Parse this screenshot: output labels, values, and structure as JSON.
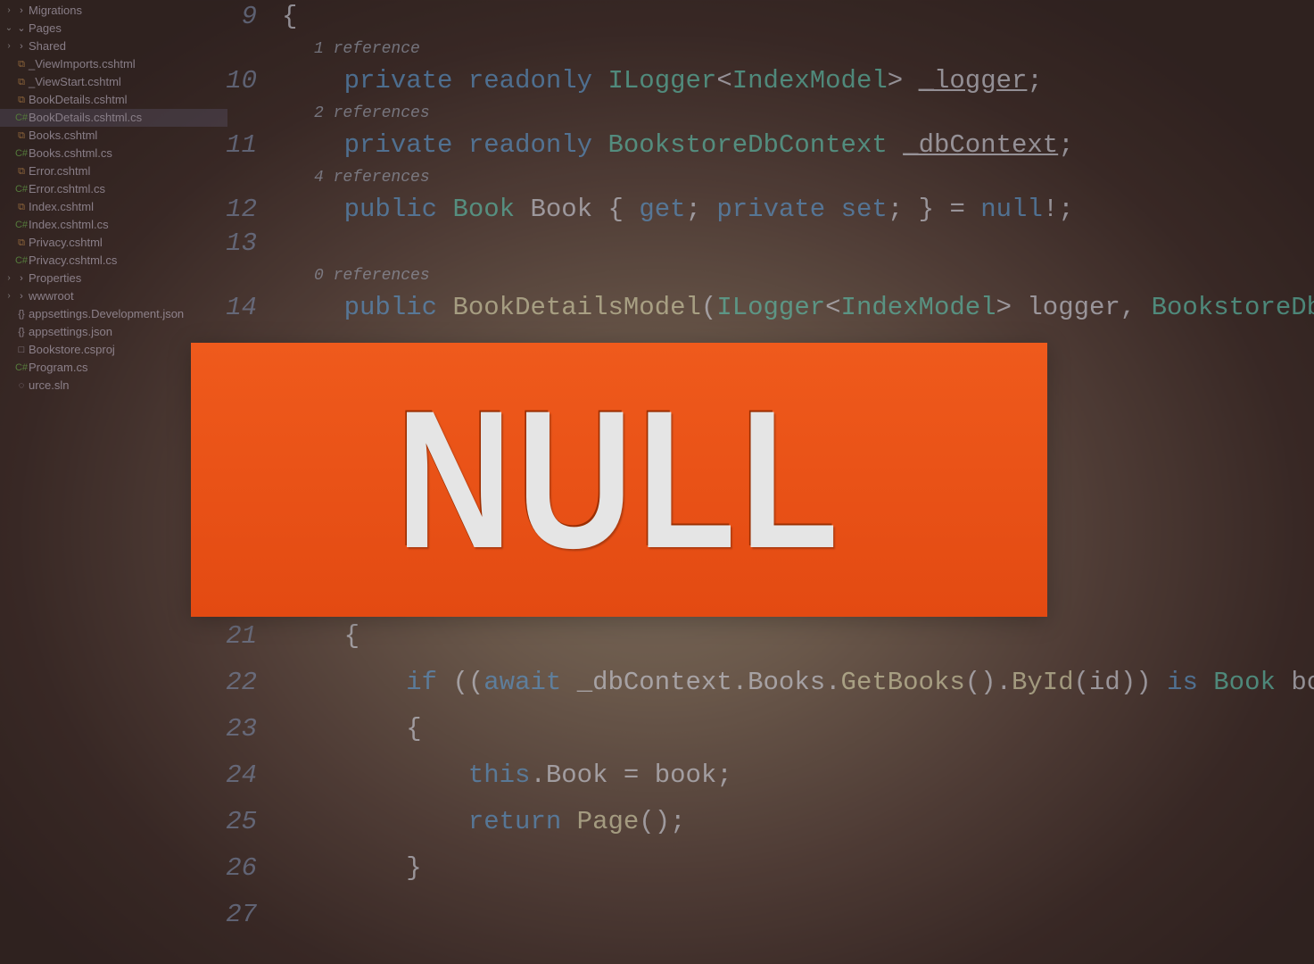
{
  "banner": {
    "text": "NULL"
  },
  "sidebar": [
    {
      "icon": "›",
      "iconClass": "",
      "label": "Migrations",
      "indent": "ind1",
      "chev": "›"
    },
    {
      "icon": "⌄",
      "iconClass": "",
      "label": "Pages",
      "indent": "ind1",
      "chev": "⌄"
    },
    {
      "icon": "›",
      "iconClass": "",
      "label": "Shared",
      "indent": "ind2",
      "chev": "›"
    },
    {
      "icon": "⧉",
      "iconClass": "icon-html",
      "label": "_ViewImports.cshtml",
      "indent": "ind2"
    },
    {
      "icon": "⧉",
      "iconClass": "icon-html",
      "label": "_ViewStart.cshtml",
      "indent": "ind2"
    },
    {
      "icon": "⧉",
      "iconClass": "icon-html",
      "label": "BookDetails.cshtml",
      "indent": "ind2"
    },
    {
      "icon": "C#",
      "iconClass": "icon-cs",
      "label": "BookDetails.cshtml.cs",
      "indent": "ind2",
      "sel": true
    },
    {
      "icon": "⧉",
      "iconClass": "icon-html",
      "label": "Books.cshtml",
      "indent": "ind2"
    },
    {
      "icon": "C#",
      "iconClass": "icon-cs",
      "label": "Books.cshtml.cs",
      "indent": "ind2"
    },
    {
      "icon": "⧉",
      "iconClass": "icon-html",
      "label": "Error.cshtml",
      "indent": "ind2"
    },
    {
      "icon": "C#",
      "iconClass": "icon-cs",
      "label": "Error.cshtml.cs",
      "indent": "ind2"
    },
    {
      "icon": "⧉",
      "iconClass": "icon-html",
      "label": "Index.cshtml",
      "indent": "ind2"
    },
    {
      "icon": "C#",
      "iconClass": "icon-cs",
      "label": "Index.cshtml.cs",
      "indent": "ind2"
    },
    {
      "icon": "⧉",
      "iconClass": "icon-html",
      "label": "Privacy.cshtml",
      "indent": "ind2"
    },
    {
      "icon": "C#",
      "iconClass": "icon-cs",
      "label": "Privacy.cshtml.cs",
      "indent": "ind2"
    },
    {
      "icon": "›",
      "iconClass": "",
      "label": "Properties",
      "indent": "ind0",
      "chev": "›"
    },
    {
      "icon": "›",
      "iconClass": "",
      "label": "wwwroot",
      "indent": "ind0",
      "chev": "›"
    },
    {
      "icon": "{}",
      "iconClass": "",
      "label": "appsettings.Development.json",
      "indent": "indm1"
    },
    {
      "icon": "{}",
      "iconClass": "",
      "label": "appsettings.json",
      "indent": "indm1"
    },
    {
      "icon": "□",
      "iconClass": "",
      "label": "Bookstore.csproj",
      "indent": "indm1"
    },
    {
      "icon": "C#",
      "iconClass": "icon-cs",
      "label": "Program.cs",
      "indent": "indm1"
    },
    {
      "icon": "◌",
      "iconClass": "",
      "label": "urce.sln",
      "indent": "indm2"
    }
  ],
  "code": {
    "ref1": "1 reference",
    "ref2": "2 references",
    "ref4": "4 references",
    "ref0": "0 references",
    "l9": "{",
    "l10": "    private readonly ILogger<IndexModel> _logger;",
    "l11": "    private readonly BookstoreDbContext _dbContext;",
    "l12": "    public Book Book { get; private set; } = null!;",
    "l13": "",
    "l14": "    public BookDetailsModel(ILogger<IndexModel> logger, BookstoreDbContext dbContext)",
    "l21": "    {",
    "l22": "        if ((await _dbContext.Books.GetBooks().ById(id)) is Book book)",
    "l23": "        {",
    "l24": "            this.Book = book;",
    "l25": "            return Page();",
    "l26": "        }",
    "l27": ""
  },
  "lineNumbers": {
    "n9": "9",
    "n10": "10",
    "n11": "11",
    "n12": "12",
    "n13": "13",
    "n14": "14",
    "n21": "21",
    "n22": "22",
    "n23": "23",
    "n24": "24",
    "n25": "25",
    "n26": "26",
    "n27": "27"
  }
}
